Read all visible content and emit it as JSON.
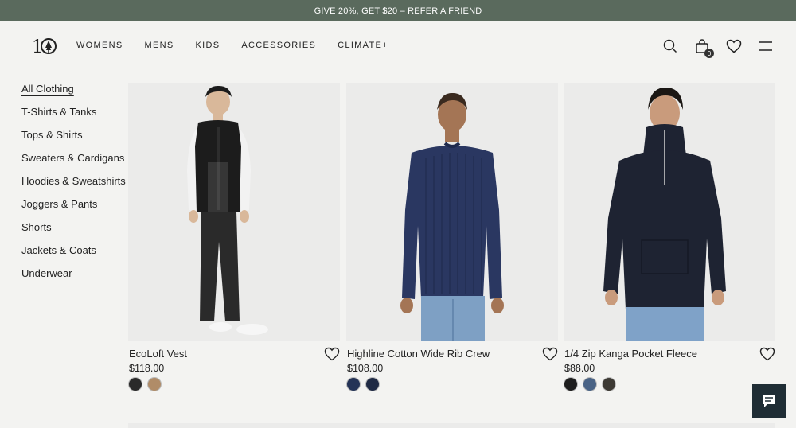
{
  "promo": {
    "text": "GIVE 20%, GET $20 – REFER A FRIEND"
  },
  "header": {
    "logo_text": "10",
    "nav": [
      "WOMENS",
      "MENS",
      "KIDS",
      "ACCESSORIES",
      "CLIMATE+"
    ],
    "bag_count": "0",
    "icons": [
      "search-icon",
      "bag-icon",
      "heart-icon",
      "menu-icon"
    ]
  },
  "sidebar": {
    "items": [
      "All Clothing",
      "T-Shirts & Tanks",
      "Tops & Shirts",
      "Sweaters & Cardigans",
      "Hoodies & Sweatshirts",
      "Joggers & Pants",
      "Shorts",
      "Jackets & Coats",
      "Underwear"
    ],
    "active": "All Clothing"
  },
  "products": [
    {
      "name": "EcoLoft Vest",
      "price": "$118.00",
      "swatches": [
        "#2a2a2a",
        "#b08c68"
      ]
    },
    {
      "name": "Highline Cotton Wide Rib Crew",
      "price": "$108.00",
      "swatches": [
        "#243356",
        "#1f2a44"
      ]
    },
    {
      "name": "1/4 Zip Kanga Pocket Fleece",
      "price": "$88.00",
      "swatches": [
        "#1e1e1e",
        "#4a6385",
        "#3d3a34"
      ]
    }
  ],
  "colors": {
    "promo_bg": "#5a6a5d",
    "chat_bg": "#1f2d35"
  }
}
